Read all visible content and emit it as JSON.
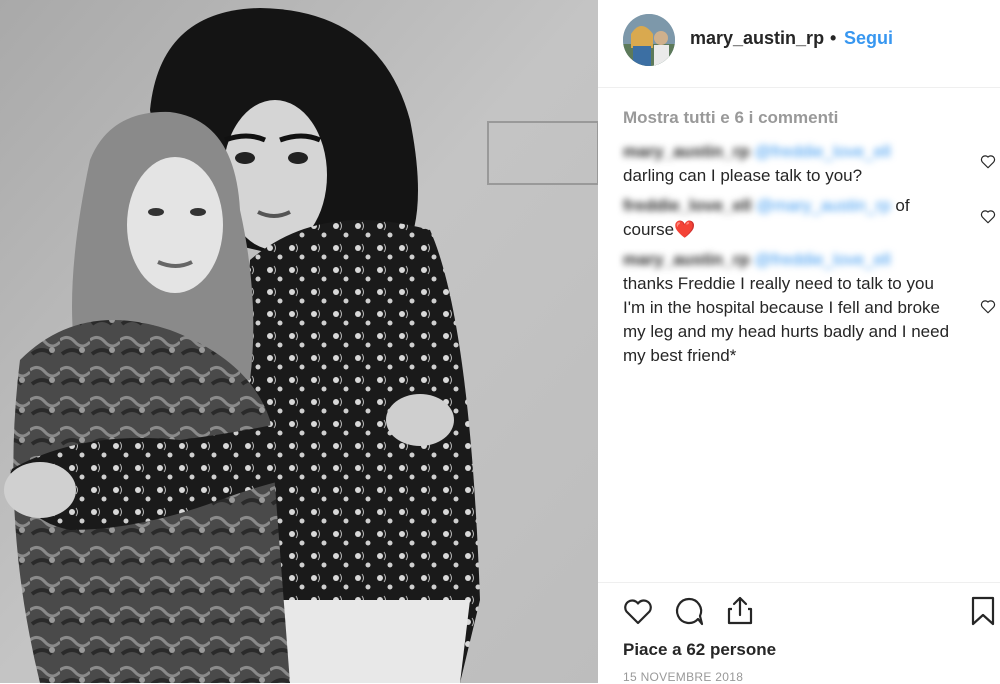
{
  "post": {
    "username": "mary_austin_rp",
    "separator": "•",
    "follow_label": "Segui",
    "show_all_comments": "Mostra tutti e 6 i commenti",
    "comments": [
      {
        "author": "mary_austin_rp",
        "mention": "@freddie_love_ell",
        "text": "darling can I please talk to you?"
      },
      {
        "author": "freddie_love_ell",
        "mention": "@mary_austin_rp",
        "text_a": "of",
        "text_b": "course",
        "emoji": "❤️"
      },
      {
        "author": "mary_austin_rp",
        "mention": "@freddie_love_ell",
        "text": "thanks Freddie I really need to talk to you I'm in the hospital because I fell and broke my leg and my head hurts badly and I need my best friend*"
      }
    ],
    "likes": "Piace a 62 persone",
    "date": "15 NOVEMBRE 2018"
  },
  "icons": {
    "like": "heart-outline-icon",
    "comment": "speech-bubble-icon",
    "share": "share-upload-icon",
    "save": "bookmark-icon",
    "comment_like": "small-heart-icon"
  },
  "colors": {
    "link": "#3897f0",
    "text": "#262626",
    "muted": "#999999",
    "divider": "#efefef"
  }
}
